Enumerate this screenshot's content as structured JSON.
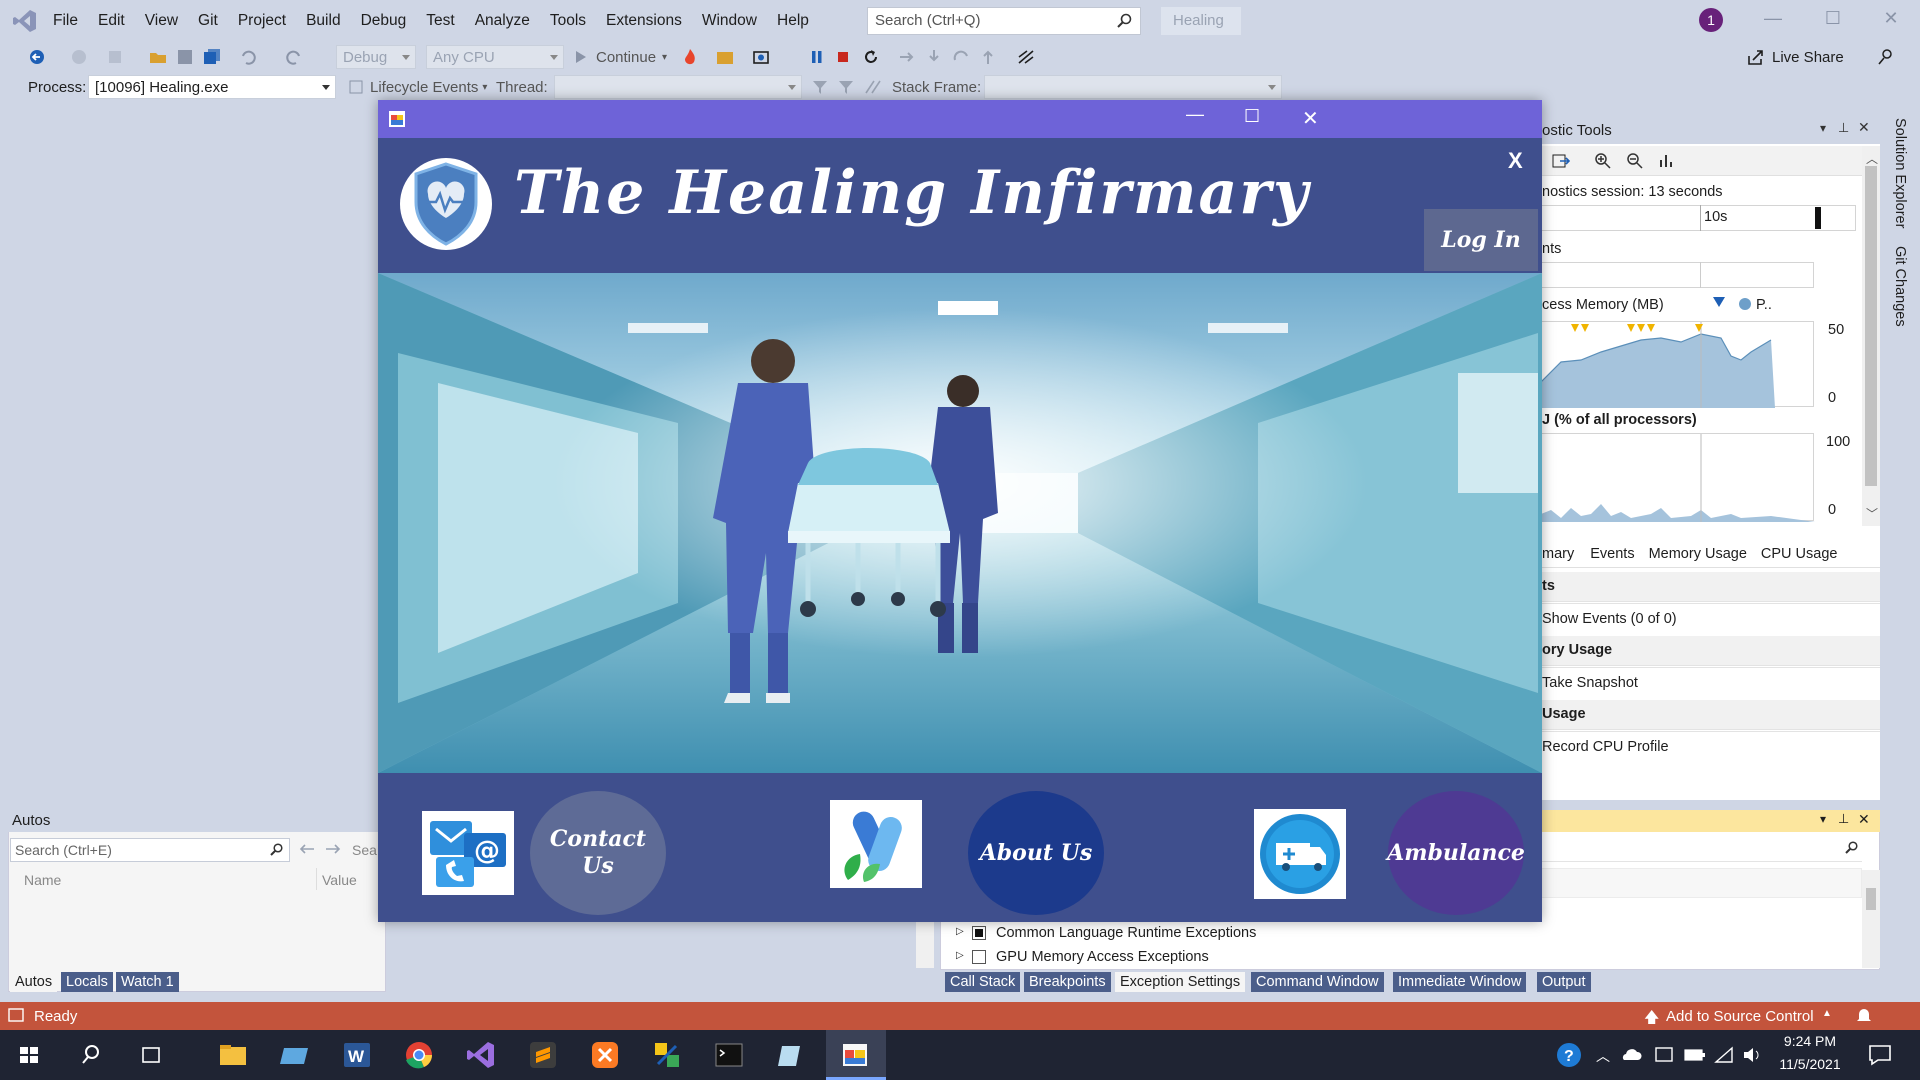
{
  "vs": {
    "menu": [
      "File",
      "Edit",
      "View",
      "Git",
      "Project",
      "Build",
      "Debug",
      "Test",
      "Analyze",
      "Tools",
      "Extensions",
      "Window",
      "Help"
    ],
    "search_placeholder": "Search (Ctrl+Q)",
    "solution_name": "Healing",
    "user_badge": "1",
    "live_share": "Live Share",
    "toolbar": {
      "config": "Debug",
      "platform": "Any CPU",
      "continue": "Continue"
    },
    "process_bar": {
      "process_label": "Process:",
      "process_value": "[10096] Healing.exe",
      "lifecycle": "Lifecycle Events",
      "thread_label": "Thread:",
      "stack_frame_label": "Stack Frame:"
    },
    "autos": {
      "title": "Autos",
      "search_placeholder": "Search (Ctrl+E)",
      "search_depth": "Sea",
      "col_name": "Name",
      "col_value": "Value",
      "tabs": [
        "Autos",
        "Locals",
        "Watch 1"
      ],
      "active_tab": "Autos"
    },
    "diagnostics": {
      "title": "ostic Tools",
      "session": "nostics session: 13 seconds",
      "timeline_tick": "10s",
      "events_label": "nts",
      "memory_label": "cess Memory (MB)",
      "memory_legend": "P..",
      "memory_max": "50",
      "memory_min": "0",
      "cpu_label": "J (% of all processors)",
      "cpu_max": "100",
      "cpu_min": "0",
      "tabs": [
        "mary",
        "Events",
        "Memory Usage",
        "CPU Usage"
      ],
      "sections": [
        {
          "heading": "ts",
          "action": "Show Events (0 of 0)"
        },
        {
          "heading": "ory Usage",
          "action": "Take Snapshot"
        },
        {
          "heading": "Usage",
          "action": "Record CPU Profile"
        }
      ]
    },
    "exceptions": {
      "items": [
        "Common Language Runtime Exceptions",
        "GPU Memory Access Exceptions"
      ],
      "tabs": [
        "Call Stack",
        "Breakpoints",
        "Exception Settings",
        "Command Window",
        "Immediate Window",
        "Output"
      ],
      "active_tab": "Exception Settings"
    },
    "status": {
      "text": "Ready",
      "source_control": "Add to Source Control"
    }
  },
  "app": {
    "title": "The Healing Infirmary",
    "close_x": "X",
    "login": "Log In",
    "footer_buttons": [
      {
        "label_line1": "Contact",
        "label_line2": "Us"
      },
      {
        "label_line1": "About Us",
        "label_line2": ""
      },
      {
        "label_line1": "Ambulance",
        "label_line2": ""
      }
    ],
    "colors": {
      "header_bg": "#3f4f8d",
      "titlebar": "#6e63d8",
      "contact_btn": "#5e6b96",
      "about_btn": "#1c3a8c",
      "ambulance_btn": "#4e3a93"
    }
  },
  "taskbar": {
    "time": "9:24 PM",
    "date": "11/5/2021"
  }
}
